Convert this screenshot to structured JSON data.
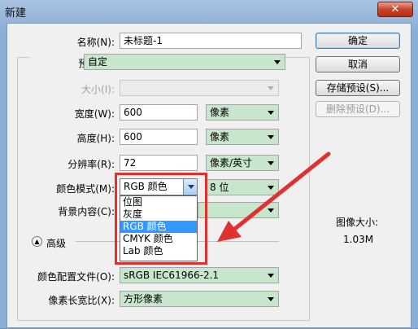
{
  "window": {
    "title": "新建",
    "close_glyph": "✕"
  },
  "form": {
    "name_label": "名称(N):",
    "name_value": "未标题-1",
    "preset_label": "预设(P):",
    "preset_value": "自定",
    "size_label": "大小(I):",
    "width_label": "宽度(W):",
    "width_value": "600",
    "width_unit": "像素",
    "height_label": "高度(H):",
    "height_value": "600",
    "height_unit": "像素",
    "resolution_label": "分辨率(R):",
    "resolution_value": "72",
    "resolution_unit": "像素/英寸",
    "color_mode_label": "颜色模式(M):",
    "color_mode_value": "RGB 颜色",
    "bit_depth_value": "8 位",
    "background_label": "背景内容(C):",
    "advanced_label": "高级",
    "profile_label": "颜色配置文件(O):",
    "profile_value": "sRGB IEC61966-2.1",
    "pixel_aspect_label": "像素长宽比(X):",
    "pixel_aspect_value": "方形像素"
  },
  "color_mode_options": [
    "位图",
    "灰度",
    "RGB 颜色",
    "CMYK 颜色",
    "Lab 颜色"
  ],
  "selected_option": "RGB 颜色",
  "buttons": {
    "ok": "确定",
    "cancel": "取消",
    "save_preset": "存储预设(S)...",
    "delete_preset": "删除预设(D)..."
  },
  "image_size": {
    "label": "图像大小:",
    "value": "1.03M"
  },
  "colors": {
    "highlight": "#3399ff",
    "annotation_red": "#e03030",
    "field_green": "#c8e6cc"
  }
}
